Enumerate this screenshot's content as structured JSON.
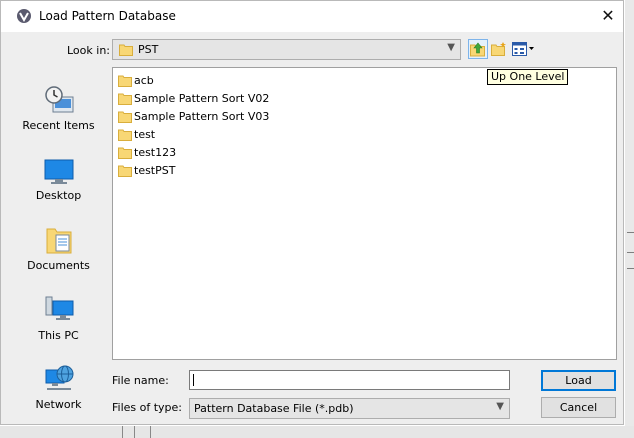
{
  "window": {
    "title": "Load Pattern Database",
    "close_glyph": "✕"
  },
  "lookin": {
    "label": "Look in:",
    "value": "PST"
  },
  "toolbar": {
    "up_tooltip": "Up One Level"
  },
  "places": [
    {
      "label": "Recent Items",
      "icon": "recent-items-icon"
    },
    {
      "label": "Desktop",
      "icon": "desktop-icon"
    },
    {
      "label": "Documents",
      "icon": "documents-icon"
    },
    {
      "label": "This PC",
      "icon": "this-pc-icon"
    },
    {
      "label": "Network",
      "icon": "network-icon"
    }
  ],
  "files": [
    {
      "name": "acb"
    },
    {
      "name": "Sample Pattern Sort V02"
    },
    {
      "name": "Sample Pattern Sort V03"
    },
    {
      "name": "test"
    },
    {
      "name": "test123"
    },
    {
      "name": "testPST"
    }
  ],
  "filename": {
    "label": "File name:",
    "value": ""
  },
  "filetype": {
    "label": "Files of type:",
    "value": "Pattern Database File (*.pdb)"
  },
  "buttons": {
    "load": "Load",
    "cancel": "Cancel"
  },
  "colors": {
    "folder": "#f8d775",
    "accent": "#0078d7",
    "tooltip_bg": "#ffffe1"
  }
}
